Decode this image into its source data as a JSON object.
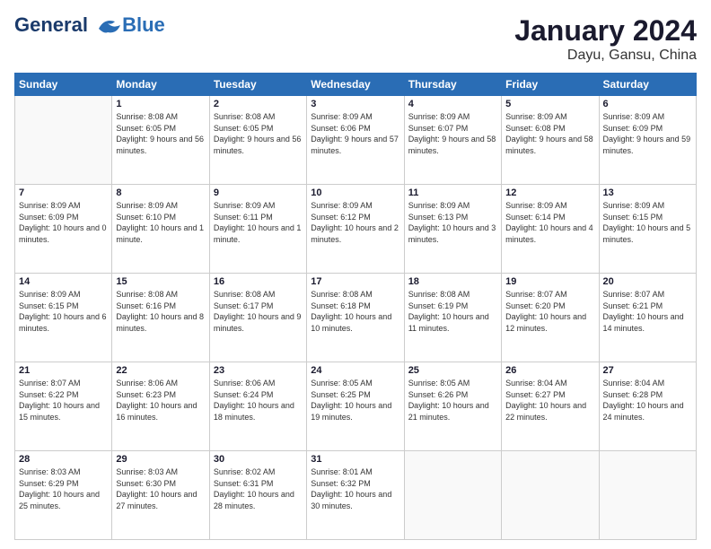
{
  "logo": {
    "line1": "General",
    "line2": "Blue"
  },
  "header": {
    "month": "January 2024",
    "location": "Dayu, Gansu, China"
  },
  "weekdays": [
    "Sunday",
    "Monday",
    "Tuesday",
    "Wednesday",
    "Thursday",
    "Friday",
    "Saturday"
  ],
  "weeks": [
    [
      {
        "day": "",
        "sunrise": "",
        "sunset": "",
        "daylight": ""
      },
      {
        "day": "1",
        "sunrise": "8:08 AM",
        "sunset": "6:05 PM",
        "daylight": "9 hours and 56 minutes."
      },
      {
        "day": "2",
        "sunrise": "8:08 AM",
        "sunset": "6:05 PM",
        "daylight": "9 hours and 56 minutes."
      },
      {
        "day": "3",
        "sunrise": "8:09 AM",
        "sunset": "6:06 PM",
        "daylight": "9 hours and 57 minutes."
      },
      {
        "day": "4",
        "sunrise": "8:09 AM",
        "sunset": "6:07 PM",
        "daylight": "9 hours and 58 minutes."
      },
      {
        "day": "5",
        "sunrise": "8:09 AM",
        "sunset": "6:08 PM",
        "daylight": "9 hours and 58 minutes."
      },
      {
        "day": "6",
        "sunrise": "8:09 AM",
        "sunset": "6:09 PM",
        "daylight": "9 hours and 59 minutes."
      }
    ],
    [
      {
        "day": "7",
        "sunrise": "8:09 AM",
        "sunset": "6:09 PM",
        "daylight": "10 hours and 0 minutes."
      },
      {
        "day": "8",
        "sunrise": "8:09 AM",
        "sunset": "6:10 PM",
        "daylight": "10 hours and 1 minute."
      },
      {
        "day": "9",
        "sunrise": "8:09 AM",
        "sunset": "6:11 PM",
        "daylight": "10 hours and 1 minute."
      },
      {
        "day": "10",
        "sunrise": "8:09 AM",
        "sunset": "6:12 PM",
        "daylight": "10 hours and 2 minutes."
      },
      {
        "day": "11",
        "sunrise": "8:09 AM",
        "sunset": "6:13 PM",
        "daylight": "10 hours and 3 minutes."
      },
      {
        "day": "12",
        "sunrise": "8:09 AM",
        "sunset": "6:14 PM",
        "daylight": "10 hours and 4 minutes."
      },
      {
        "day": "13",
        "sunrise": "8:09 AM",
        "sunset": "6:15 PM",
        "daylight": "10 hours and 5 minutes."
      }
    ],
    [
      {
        "day": "14",
        "sunrise": "8:09 AM",
        "sunset": "6:15 PM",
        "daylight": "10 hours and 6 minutes."
      },
      {
        "day": "15",
        "sunrise": "8:08 AM",
        "sunset": "6:16 PM",
        "daylight": "10 hours and 8 minutes."
      },
      {
        "day": "16",
        "sunrise": "8:08 AM",
        "sunset": "6:17 PM",
        "daylight": "10 hours and 9 minutes."
      },
      {
        "day": "17",
        "sunrise": "8:08 AM",
        "sunset": "6:18 PM",
        "daylight": "10 hours and 10 minutes."
      },
      {
        "day": "18",
        "sunrise": "8:08 AM",
        "sunset": "6:19 PM",
        "daylight": "10 hours and 11 minutes."
      },
      {
        "day": "19",
        "sunrise": "8:07 AM",
        "sunset": "6:20 PM",
        "daylight": "10 hours and 12 minutes."
      },
      {
        "day": "20",
        "sunrise": "8:07 AM",
        "sunset": "6:21 PM",
        "daylight": "10 hours and 14 minutes."
      }
    ],
    [
      {
        "day": "21",
        "sunrise": "8:07 AM",
        "sunset": "6:22 PM",
        "daylight": "10 hours and 15 minutes."
      },
      {
        "day": "22",
        "sunrise": "8:06 AM",
        "sunset": "6:23 PM",
        "daylight": "10 hours and 16 minutes."
      },
      {
        "day": "23",
        "sunrise": "8:06 AM",
        "sunset": "6:24 PM",
        "daylight": "10 hours and 18 minutes."
      },
      {
        "day": "24",
        "sunrise": "8:05 AM",
        "sunset": "6:25 PM",
        "daylight": "10 hours and 19 minutes."
      },
      {
        "day": "25",
        "sunrise": "8:05 AM",
        "sunset": "6:26 PM",
        "daylight": "10 hours and 21 minutes."
      },
      {
        "day": "26",
        "sunrise": "8:04 AM",
        "sunset": "6:27 PM",
        "daylight": "10 hours and 22 minutes."
      },
      {
        "day": "27",
        "sunrise": "8:04 AM",
        "sunset": "6:28 PM",
        "daylight": "10 hours and 24 minutes."
      }
    ],
    [
      {
        "day": "28",
        "sunrise": "8:03 AM",
        "sunset": "6:29 PM",
        "daylight": "10 hours and 25 minutes."
      },
      {
        "day": "29",
        "sunrise": "8:03 AM",
        "sunset": "6:30 PM",
        "daylight": "10 hours and 27 minutes."
      },
      {
        "day": "30",
        "sunrise": "8:02 AM",
        "sunset": "6:31 PM",
        "daylight": "10 hours and 28 minutes."
      },
      {
        "day": "31",
        "sunrise": "8:01 AM",
        "sunset": "6:32 PM",
        "daylight": "10 hours and 30 minutes."
      },
      {
        "day": "",
        "sunrise": "",
        "sunset": "",
        "daylight": ""
      },
      {
        "day": "",
        "sunrise": "",
        "sunset": "",
        "daylight": ""
      },
      {
        "day": "",
        "sunrise": "",
        "sunset": "",
        "daylight": ""
      }
    ]
  ],
  "labels": {
    "sunrise_prefix": "Sunrise: ",
    "sunset_prefix": "Sunset: ",
    "daylight_prefix": "Daylight: "
  }
}
